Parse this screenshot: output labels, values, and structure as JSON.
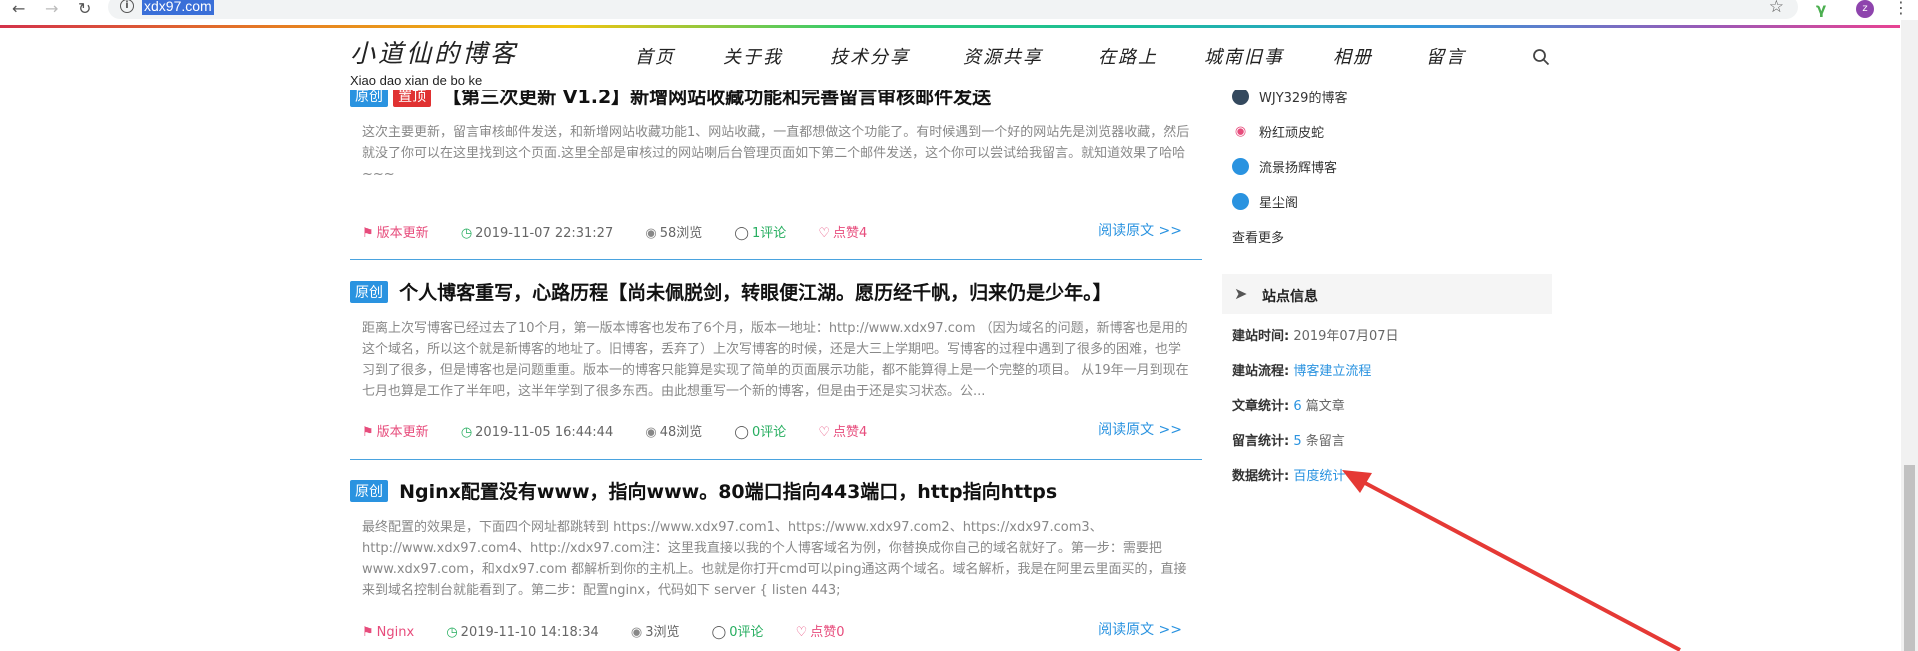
{
  "browser": {
    "url": "xdx97.com",
    "profile_initial": "z"
  },
  "site": {
    "logo_title": "小道仙的博客",
    "logo_subtitle": "Xiao dao xian de bo ke",
    "nav": [
      "首页",
      "关于我",
      "技术分享",
      "资源共享",
      "在路上",
      "城南旧事",
      "相册",
      "留言"
    ]
  },
  "articles": [
    {
      "badges": [
        "原创",
        "置顶"
      ],
      "title": "【第三次更新 V1.2】新增网站收藏功能和完善留言审核邮件发送",
      "excerpt": "这次主要更新，留言审核邮件发送，和新增网站收藏功能1、网站收藏，一直都想做这个功能了。有时候遇到一个好的网站先是浏览器收藏，然后就没了你可以在这里找到这个页面.这里全部是审核过的网站喇后台管理页面如下第二个邮件发送，这个你可以尝试给我留言。就知道效果了哈哈~~~",
      "tag": "版本更新",
      "time": "2019-11-07 22:31:27",
      "views": "58浏览",
      "comments": "1评论",
      "likes": "点赞4",
      "read_more": "阅读原文 >>"
    },
    {
      "badges": [
        "原创"
      ],
      "title": "个人博客重写，心路历程【尚未佩脱剑，转眼便江湖。愿历经千帆，归来仍是少年。】",
      "excerpt": "距离上次写博客已经过去了10个月，第一版本博客也发布了6个月，版本一地址：http://www.xdx97.com （因为域名的问题，新博客也是用的这个域名，所以这个就是新博客的地址了。旧博客，丢弃了）上次写博客的时候，还是大三上学期吧。写博客的过程中遇到了很多的困难，也学习到了很多，但是博客也是问题重重。版本一的博客只能算是实现了简单的页面展示功能，都不能算得上是一个完整的项目。 从19年一月到现在七月也算是工作了半年吧，这半年学到了很多东西。由此想重写一个新的博客，但是由于还是实习状态。公...",
      "tag": "版本更新",
      "time": "2019-11-05 16:44:44",
      "views": "48浏览",
      "comments": "0评论",
      "likes": "点赞4",
      "read_more": "阅读原文 >>"
    },
    {
      "badges": [
        "原创"
      ],
      "title": "Nginx配置没有www，指向www。80端口指向443端口，http指向https",
      "excerpt": "最终配置的效果是，下面四个网址都跳转到 https://www.xdx97.com1、https://www.xdx97.com2、https://xdx97.com3、http://www.xdx97.com4、http://xdx97.com注：这里我直接以我的个人博客域名为例，你替换成你自己的域名就好了。第一步：需要把www.xdx97.com，和xdx97.com 都解析到你的主机上。也就是你打开cmd可以ping通这两个域名。域名解析，我是在阿里云里面买的，直接来到域名控制台就能看到了。第二步：配置nginx，代码如下 server { listen 443;",
      "tag": "Nginx",
      "time": "2019-11-10 14:18:34",
      "views": "3浏览",
      "comments": "0评论",
      "likes": "点赞0",
      "read_more": "阅读原文 >>"
    }
  ],
  "sidebar": {
    "links": [
      {
        "name": "WJY329的博客",
        "color": "#34495e"
      },
      {
        "name": "粉红顽皮蛇",
        "color": "#e74c7c"
      },
      {
        "name": "流景扬辉博客",
        "color": "#2a93e0"
      },
      {
        "name": "星尘阁",
        "color": "#2a93e0"
      }
    ],
    "see_more": "查看更多",
    "info_title": "站点信息",
    "info": {
      "build_time_label": "建站时间:",
      "build_time_value": "2019年07月07日",
      "build_flow_label": "建站流程:",
      "build_flow_value": "博客建立流程",
      "articles_label": "文章统计:",
      "articles_count": "6",
      "articles_suffix": "篇文章",
      "comments_label": "留言统计:",
      "comments_count": "5",
      "comments_suffix": "条留言",
      "stats_label": "数据统计:",
      "stats_value": "百度统计"
    }
  }
}
